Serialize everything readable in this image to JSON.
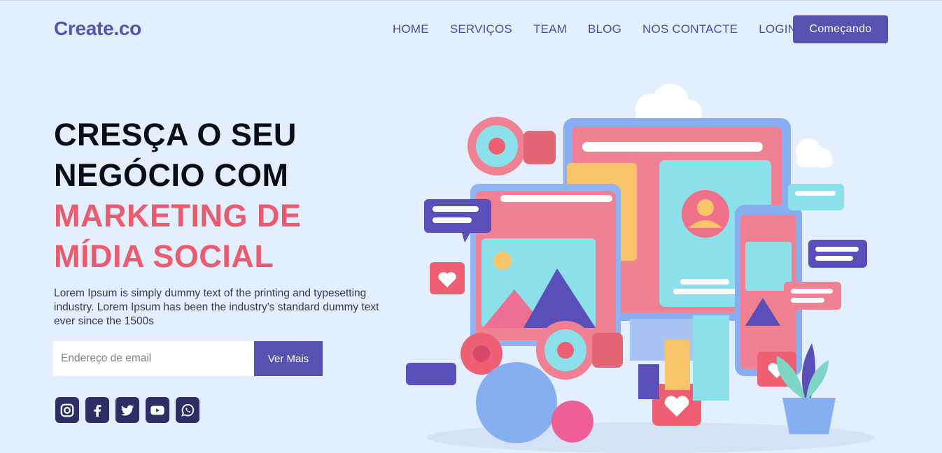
{
  "brand": {
    "logo": "Create.co"
  },
  "nav": {
    "items": [
      "HOME",
      "SERVIÇOS",
      "TEAM",
      "BLOG",
      "NOS CONTACTE",
      "LOGIN"
    ],
    "cta_label": "Começando"
  },
  "hero": {
    "title_line1": "CRESÇA O SEU",
    "title_line2": "NEGÓCIO COM",
    "title_line3": "MARKETING DE",
    "title_line4": "MÍDIA SOCIAL",
    "description": "Lorem Ipsum is simply dummy text of the printing and typesetting industry. Lorem Ipsum has been the industry's standard dummy text ever since the 1500s",
    "email_placeholder": "Endereço de email",
    "submit_label": "Ver Mais"
  },
  "social": [
    "instagram-icon",
    "facebook-icon",
    "twitter-icon",
    "youtube-icon",
    "whatsapp-icon"
  ],
  "colors": {
    "background": "#e3efff",
    "brand": "#5552b0",
    "accent": "#ea5b6e",
    "social_bg": "#2f2d66"
  }
}
